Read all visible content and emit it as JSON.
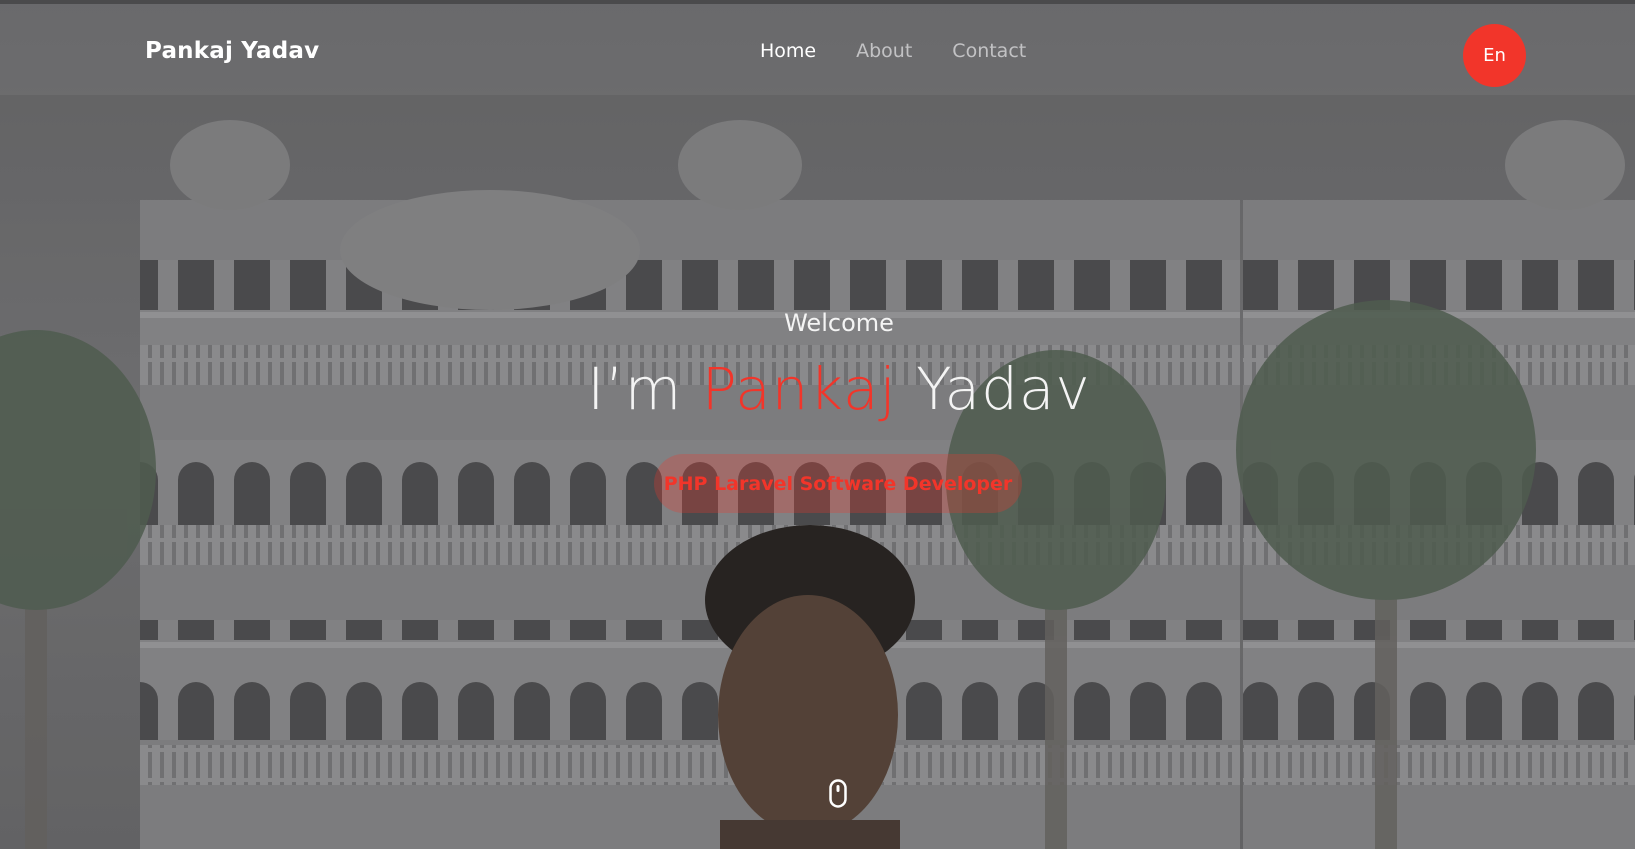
{
  "header": {
    "brand": "Pankaj Yadav",
    "nav": [
      {
        "label": "Home",
        "active": true
      },
      {
        "label": "About",
        "active": false
      },
      {
        "label": "Contact",
        "active": false
      }
    ],
    "language_button": "En"
  },
  "hero": {
    "welcome": "Welcome",
    "title_prefix": "I’m",
    "title_first": "Pankaj",
    "title_last": "Yadav",
    "role": "PHP Laravel Software Developer",
    "scroll_icon": "mouse-scroll-icon"
  },
  "colors": {
    "accent": "#f2352a",
    "text_light": "#f4f4f4",
    "nav_inactive": "#c2c2c4",
    "overlay": "#5f5f61"
  }
}
